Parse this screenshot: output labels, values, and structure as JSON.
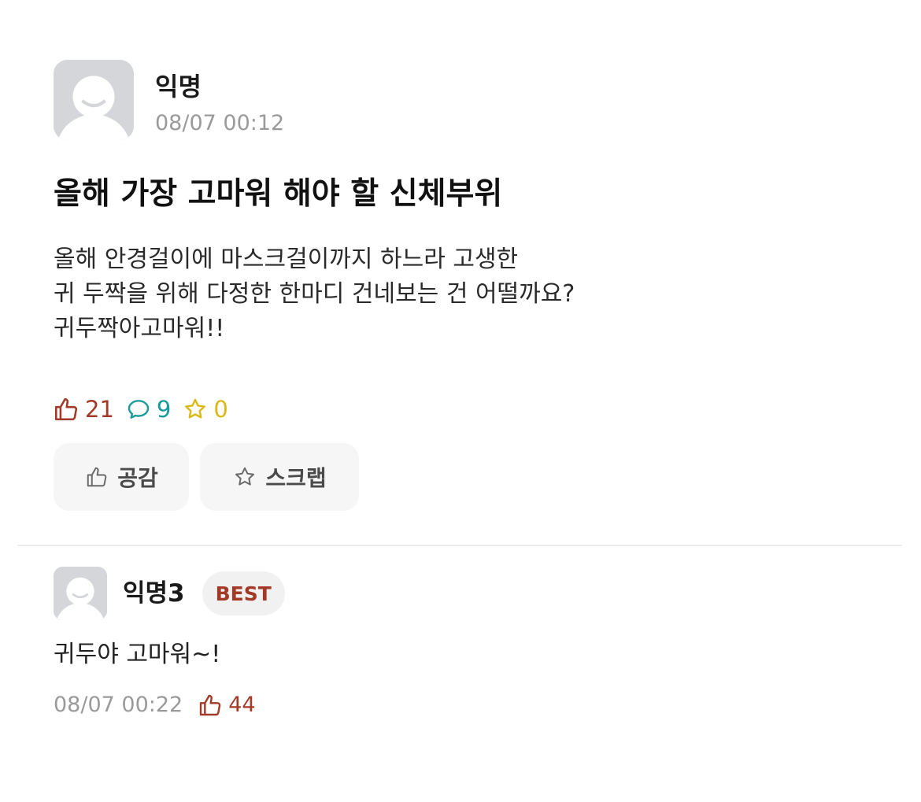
{
  "post": {
    "author": "익명",
    "time": "08/07 00:12",
    "title": "올해 가장 고마워 해야 할 신체부위",
    "body_lines": [
      "올해 안경걸이에 마스크걸이까지 하느라 고생한",
      "귀 두짝을 위해 다정한 한마디 건네보는 건 어떨까요?",
      "귀두짝아고마워!!"
    ],
    "stats": {
      "likes": "21",
      "comments": "9",
      "scraps": "0"
    },
    "actions": {
      "empathy_label": "공감",
      "scrap_label": "스크랩"
    }
  },
  "comment": {
    "author": "익명3",
    "badge": "BEST",
    "text": "귀두야 고마워~!",
    "time": "08/07 00:22",
    "likes": "44"
  },
  "colors": {
    "like": "#a33a28",
    "comment": "#1a9b9b",
    "scrap": "#d9b817",
    "badge": "#a33a28",
    "avatar_bg": "#d4d6d9"
  },
  "icons": {
    "avatar": "default-avatar-icon",
    "like": "thumbs-up-icon",
    "comment": "speech-bubble-icon",
    "scrap": "star-icon"
  }
}
